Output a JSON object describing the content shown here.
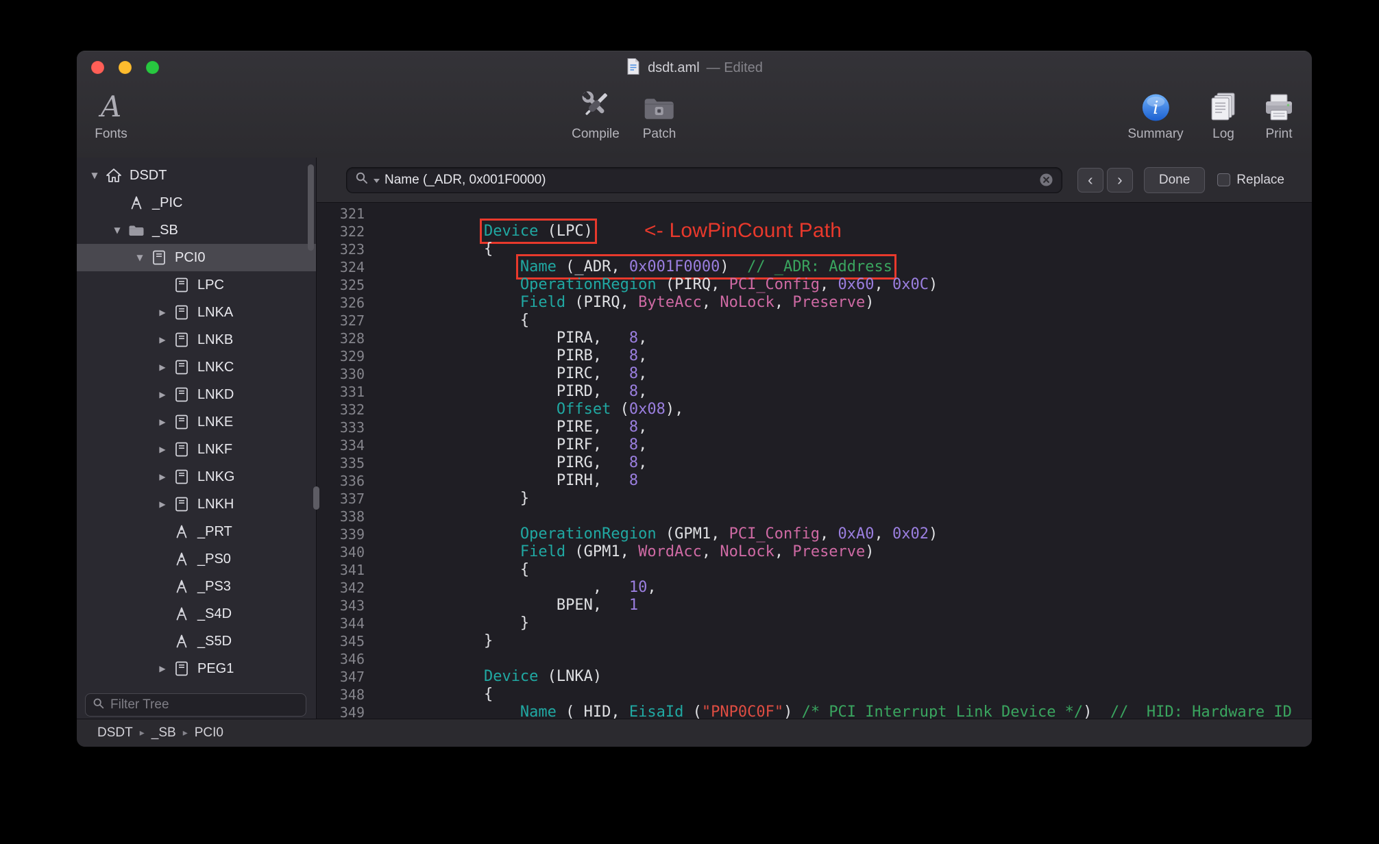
{
  "colors": {
    "accent_red": "#e8392c",
    "syntax": {
      "keyword": "#20a8a2",
      "number": "#9b7fe0",
      "predefined": "#cf6aa4",
      "string": "#df4d42",
      "comment": "#3aa55f",
      "plain": "#dfe0e3",
      "line_number": "#85858c"
    }
  },
  "window": {
    "title": "dsdt.aml",
    "edited_suffix": "— Edited"
  },
  "toolbar": {
    "items": [
      {
        "label": "Fonts",
        "glyph": "A"
      },
      {
        "label": "Compile"
      },
      {
        "label": "Patch"
      },
      {
        "label": "Summary"
      },
      {
        "label": "Log"
      },
      {
        "label": "Print"
      }
    ]
  },
  "sidebar": {
    "filter_placeholder": "Filter Tree",
    "items": [
      {
        "label": "DSDT",
        "icon": "house-icon",
        "depth": 0,
        "disclosure": "open"
      },
      {
        "label": "_PIC",
        "icon": "method-icon",
        "depth": 1,
        "disclosure": "none"
      },
      {
        "label": "_SB",
        "icon": "folder-icon",
        "depth": 1,
        "disclosure": "open"
      },
      {
        "label": "PCI0",
        "icon": "device-icon",
        "depth": 2,
        "disclosure": "open",
        "selected": true
      },
      {
        "label": "LPC",
        "icon": "device-icon",
        "depth": 3,
        "disclosure": "none"
      },
      {
        "label": "LNKA",
        "icon": "device-icon",
        "depth": 3,
        "disclosure": "closed"
      },
      {
        "label": "LNKB",
        "icon": "device-icon",
        "depth": 3,
        "disclosure": "closed"
      },
      {
        "label": "LNKC",
        "icon": "device-icon",
        "depth": 3,
        "disclosure": "closed"
      },
      {
        "label": "LNKD",
        "icon": "device-icon",
        "depth": 3,
        "disclosure": "closed"
      },
      {
        "label": "LNKE",
        "icon": "device-icon",
        "depth": 3,
        "disclosure": "closed"
      },
      {
        "label": "LNKF",
        "icon": "device-icon",
        "depth": 3,
        "disclosure": "closed"
      },
      {
        "label": "LNKG",
        "icon": "device-icon",
        "depth": 3,
        "disclosure": "closed"
      },
      {
        "label": "LNKH",
        "icon": "device-icon",
        "depth": 3,
        "disclosure": "closed"
      },
      {
        "label": "_PRT",
        "icon": "method-icon",
        "depth": 3,
        "disclosure": "none"
      },
      {
        "label": "_PS0",
        "icon": "method-icon",
        "depth": 3,
        "disclosure": "none"
      },
      {
        "label": "_PS3",
        "icon": "method-icon",
        "depth": 3,
        "disclosure": "none"
      },
      {
        "label": "_S4D",
        "icon": "method-icon",
        "depth": 3,
        "disclosure": "none"
      },
      {
        "label": "_S5D",
        "icon": "method-icon",
        "depth": 3,
        "disclosure": "none"
      },
      {
        "label": "PEG1",
        "icon": "device-icon",
        "depth": 3,
        "disclosure": "closed"
      }
    ]
  },
  "search": {
    "query": "Name (_ADR, 0x001F0000)",
    "prev_glyph": "‹",
    "next_glyph": "›",
    "done_label": "Done",
    "replace_label": "Replace"
  },
  "annotation": {
    "text": "<- LowPinCount Path"
  },
  "breadcrumb": {
    "items": [
      "DSDT",
      "_SB",
      "PCI0"
    ]
  },
  "editor": {
    "lines": [
      {
        "n": 321,
        "segs": []
      },
      {
        "n": 322,
        "segs": [
          [
            "            "
          ],
          [
            "Device",
            "k",
            1
          ],
          [
            " (LPC)",
            "w",
            1
          ]
        ]
      },
      {
        "n": 323,
        "segs": [
          [
            "            {"
          ]
        ]
      },
      {
        "n": 324,
        "segs": [
          [
            "                "
          ],
          [
            "Name",
            "k",
            1
          ],
          [
            " (_ADR, ",
            "w",
            1
          ],
          [
            "0x001F0000",
            "n",
            1
          ],
          [
            ")",
            "w",
            1
          ],
          [
            "  // _ADR: Address",
            "c",
            1
          ]
        ]
      },
      {
        "n": 325,
        "segs": [
          [
            "                "
          ],
          [
            "OperationRegion",
            "k"
          ],
          [
            " (PIRQ, "
          ],
          [
            "PCI_Config",
            "p"
          ],
          [
            ", "
          ],
          [
            "0x60",
            "n"
          ],
          [
            ", "
          ],
          [
            "0x0C",
            "n"
          ],
          [
            ")"
          ]
        ]
      },
      {
        "n": 326,
        "segs": [
          [
            "                "
          ],
          [
            "Field",
            "k"
          ],
          [
            " (PIRQ, "
          ],
          [
            "ByteAcc",
            "p"
          ],
          [
            ", "
          ],
          [
            "NoLock",
            "p"
          ],
          [
            ", "
          ],
          [
            "Preserve",
            "p"
          ],
          [
            ")"
          ]
        ]
      },
      {
        "n": 327,
        "segs": [
          [
            "                {"
          ]
        ]
      },
      {
        "n": 328,
        "segs": [
          [
            "                    PIRA,   "
          ],
          [
            "8",
            "n"
          ],
          [
            ","
          ]
        ]
      },
      {
        "n": 329,
        "segs": [
          [
            "                    PIRB,   "
          ],
          [
            "8",
            "n"
          ],
          [
            ","
          ]
        ]
      },
      {
        "n": 330,
        "segs": [
          [
            "                    PIRC,   "
          ],
          [
            "8",
            "n"
          ],
          [
            ","
          ]
        ]
      },
      {
        "n": 331,
        "segs": [
          [
            "                    PIRD,   "
          ],
          [
            "8",
            "n"
          ],
          [
            ","
          ]
        ]
      },
      {
        "n": 332,
        "segs": [
          [
            "                    "
          ],
          [
            "Offset",
            "k"
          ],
          [
            " ("
          ],
          [
            "0x08",
            "n"
          ],
          [
            "),"
          ]
        ]
      },
      {
        "n": 333,
        "segs": [
          [
            "                    PIRE,   "
          ],
          [
            "8",
            "n"
          ],
          [
            ","
          ]
        ]
      },
      {
        "n": 334,
        "segs": [
          [
            "                    PIRF,   "
          ],
          [
            "8",
            "n"
          ],
          [
            ","
          ]
        ]
      },
      {
        "n": 335,
        "segs": [
          [
            "                    PIRG,   "
          ],
          [
            "8",
            "n"
          ],
          [
            ","
          ]
        ]
      },
      {
        "n": 336,
        "segs": [
          [
            "                    PIRH,   "
          ],
          [
            "8",
            "n"
          ]
        ]
      },
      {
        "n": 337,
        "segs": [
          [
            "                }"
          ]
        ]
      },
      {
        "n": 338,
        "segs": []
      },
      {
        "n": 339,
        "segs": [
          [
            "                "
          ],
          [
            "OperationRegion",
            "k"
          ],
          [
            " (GPM1, "
          ],
          [
            "PCI_Config",
            "p"
          ],
          [
            ", "
          ],
          [
            "0xA0",
            "n"
          ],
          [
            ", "
          ],
          [
            "0x02",
            "n"
          ],
          [
            ")"
          ]
        ]
      },
      {
        "n": 340,
        "segs": [
          [
            "                "
          ],
          [
            "Field",
            "k"
          ],
          [
            " (GPM1, "
          ],
          [
            "WordAcc",
            "p"
          ],
          [
            ", "
          ],
          [
            "NoLock",
            "p"
          ],
          [
            ", "
          ],
          [
            "Preserve",
            "p"
          ],
          [
            ")"
          ]
        ]
      },
      {
        "n": 341,
        "segs": [
          [
            "                {"
          ]
        ]
      },
      {
        "n": 342,
        "segs": [
          [
            "                        ,   "
          ],
          [
            "10",
            "n"
          ],
          [
            ","
          ]
        ]
      },
      {
        "n": 343,
        "segs": [
          [
            "                    BPEN,   "
          ],
          [
            "1",
            "n"
          ]
        ]
      },
      {
        "n": 344,
        "segs": [
          [
            "                }"
          ]
        ]
      },
      {
        "n": 345,
        "segs": [
          [
            "            }"
          ]
        ]
      },
      {
        "n": 346,
        "segs": []
      },
      {
        "n": 347,
        "segs": [
          [
            "            "
          ],
          [
            "Device",
            "k"
          ],
          [
            " (LNKA)"
          ]
        ]
      },
      {
        "n": 348,
        "segs": [
          [
            "            {"
          ]
        ]
      },
      {
        "n": 349,
        "segs": [
          [
            "                "
          ],
          [
            "Name",
            "k"
          ],
          [
            " (_HID, "
          ],
          [
            "EisaId",
            "k"
          ],
          [
            " ("
          ],
          [
            "\"PNP0C0F\"",
            "s"
          ],
          [
            ") "
          ],
          [
            "/* PCI Interrupt Link Device */",
            "c"
          ],
          [
            ")"
          ],
          [
            "  // _HID: Hardware ID",
            "c"
          ]
        ]
      }
    ]
  }
}
